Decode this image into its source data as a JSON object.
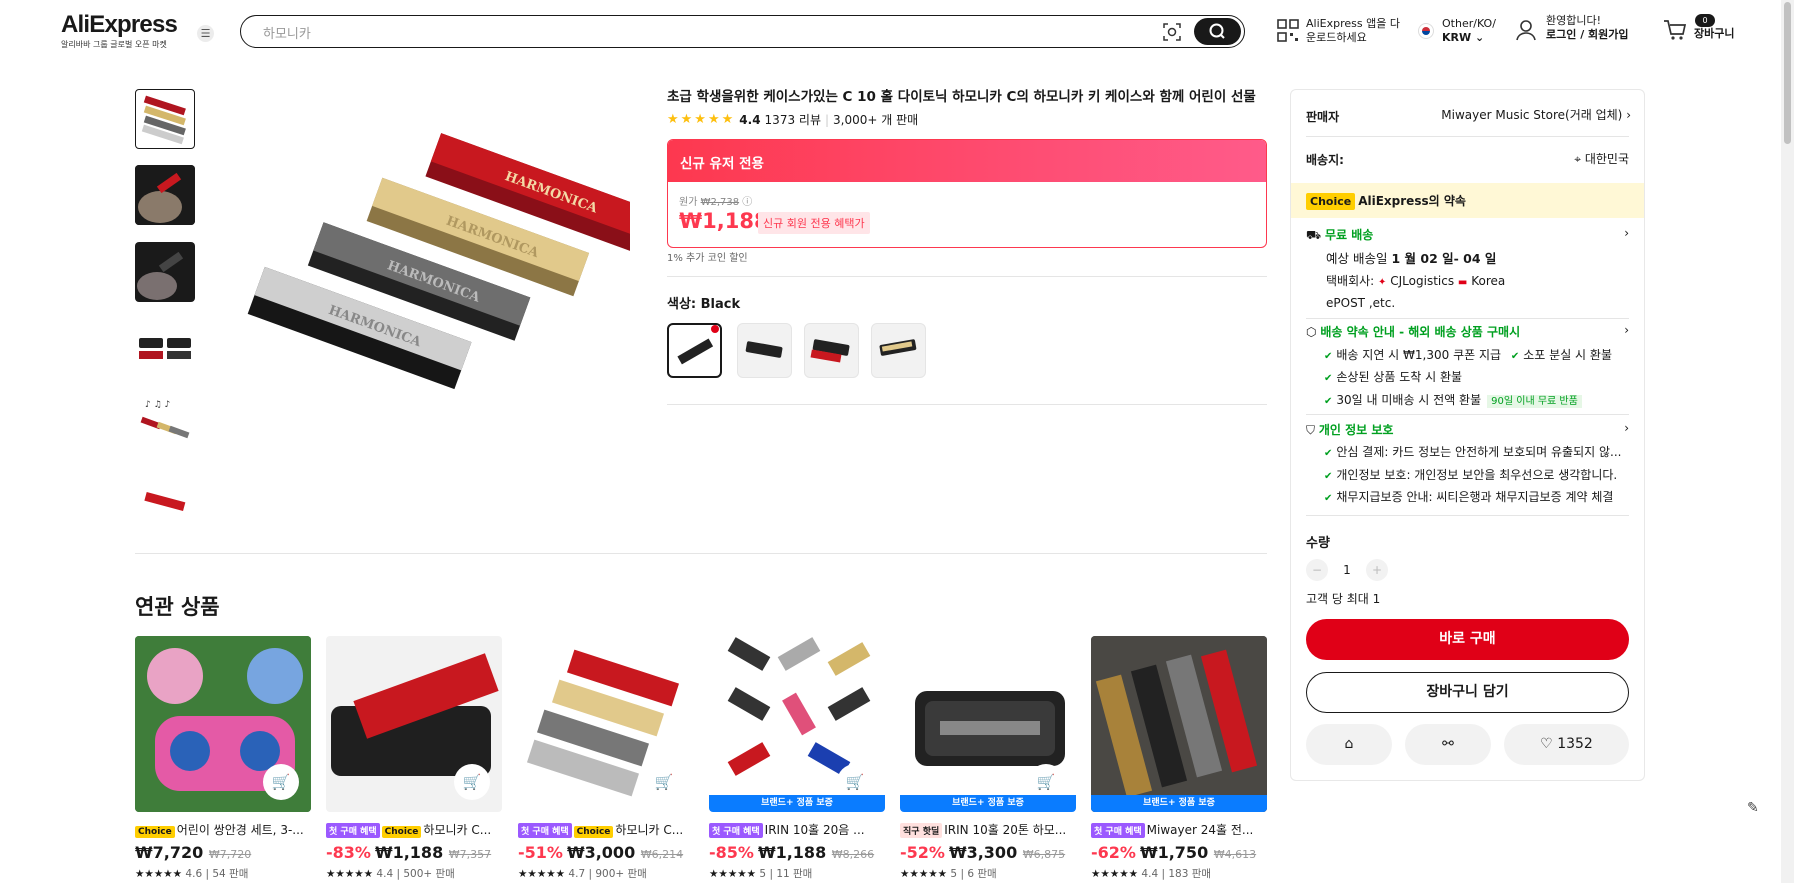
{
  "header": {
    "logo": "AliExpress",
    "logo_sub": "알리바바 그룹 글로벌 오픈 마켓",
    "search_placeholder": "하모니카",
    "app_download": [
      "AliExpress 앱을 다",
      "운로드하세요"
    ],
    "region": [
      "Other/KO/",
      "KRW"
    ],
    "account": [
      "환영합니다!",
      "로그인 / 회원가입"
    ],
    "cart_count": "0",
    "cart_label": "장바구니"
  },
  "product": {
    "title": "초급 학생을위한 케이스가있는 C 10 홀 다이토닉 하모니카 C의 하모니카 키 케이스와 함께 어린이 선물",
    "rating": "4.4",
    "reviews": "1373 리뷰",
    "sold": "3,000+ 개 판매",
    "price_band": "신규 유저 전용",
    "orig_label": "원가",
    "orig_price": "₩2,738",
    "price": "₩1,188",
    "price_tag": "신규 회원 전용 혜택가",
    "coin": "1% 추가 코인 할인",
    "color_label": "색상: Black"
  },
  "side": {
    "seller_label": "판매자",
    "seller_name": "Miwayer Music Store(거래 업체)",
    "ship_label": "배송지:",
    "ship_country": "대한민국",
    "choice_tag": "Choice",
    "choice_promise": "AliExpress의 약속",
    "free_ship": "무료 배송",
    "eta_prefix": "예상 배송일",
    "eta": "1 월 02 일- 04 일",
    "carrier_label": "택배회사:",
    "carrier": "CJLogistics",
    "carrier2": "Korea",
    "carrier3": "ePOST ,etc.",
    "promise_title": "배송 약속 안내 - 해외 배송 상품 구매시",
    "promise_items": [
      "배송 지연 시 ₩1,300 쿠폰 지급",
      "소포 분실 시 환불",
      "손상된 상품 도착 시 환불",
      "30일 내 미배송 시 전액 환불"
    ],
    "return_tag": "90일 이내 무료 반품",
    "privacy_title": "개인 정보 보호",
    "privacy_items": [
      "안심 결제: 카드 정보는 안전하게 보호되며 유출되지 않...",
      "개인정보 보호: 개인정보 보안을 최우선으로 생각합니다.",
      "채무지급보증 안내: 씨티은행과 채무지급보증 계약 체결"
    ],
    "qty_label": "수량",
    "qty": "1",
    "limit": "고객 당 최대 1",
    "buy_now": "바로 구매",
    "add_cart": "장바구니 담기",
    "wishlist": "1352"
  },
  "related": {
    "title": "연관 상품",
    "items": [
      {
        "badges": [
          "Choice"
        ],
        "title": "어린이 쌍안경 세트, 3-...",
        "disc": "",
        "price": "₩7,720",
        "orig": "₩7,720",
        "rating": "4.6 | 54 판매",
        "brand": ""
      },
      {
        "badges": [
          "첫 구매 혜택",
          "Choice"
        ],
        "title": "하모니카 C...",
        "disc": "-83%",
        "price": "₩1,188",
        "orig": "₩7,357",
        "rating": "4.4 | 500+ 판매",
        "brand": ""
      },
      {
        "badges": [
          "첫 구매 혜택",
          "Choice"
        ],
        "title": "하모니카 C...",
        "disc": "-51%",
        "price": "₩3,000",
        "orig": "₩6,214",
        "rating": "4.7 | 900+ 판매",
        "brand": ""
      },
      {
        "badges": [
          "첫 구매 혜택"
        ],
        "title": "IRIN 10홀 20음 ...",
        "disc": "-85%",
        "price": "₩1,188",
        "orig": "₩8,266",
        "rating": "5 | 11 판매",
        "brand": "브랜드+ 정품 보증"
      },
      {
        "badges": [
          "직구 핫딜"
        ],
        "title": "IRIN 10홀 20톤 하모...",
        "disc": "-52%",
        "price": "₩3,300",
        "orig": "₩6,875",
        "rating": "5 | 6 판매",
        "brand": "브랜드+ 정품 보증"
      },
      {
        "badges": [
          "첫 구매 혜택"
        ],
        "title": "Miwayer 24홀 전...",
        "disc": "-62%",
        "price": "₩1,750",
        "orig": "₩4,613",
        "rating": "4.4 | 183 판매",
        "brand": "브랜드+ 정품 보증"
      }
    ]
  }
}
